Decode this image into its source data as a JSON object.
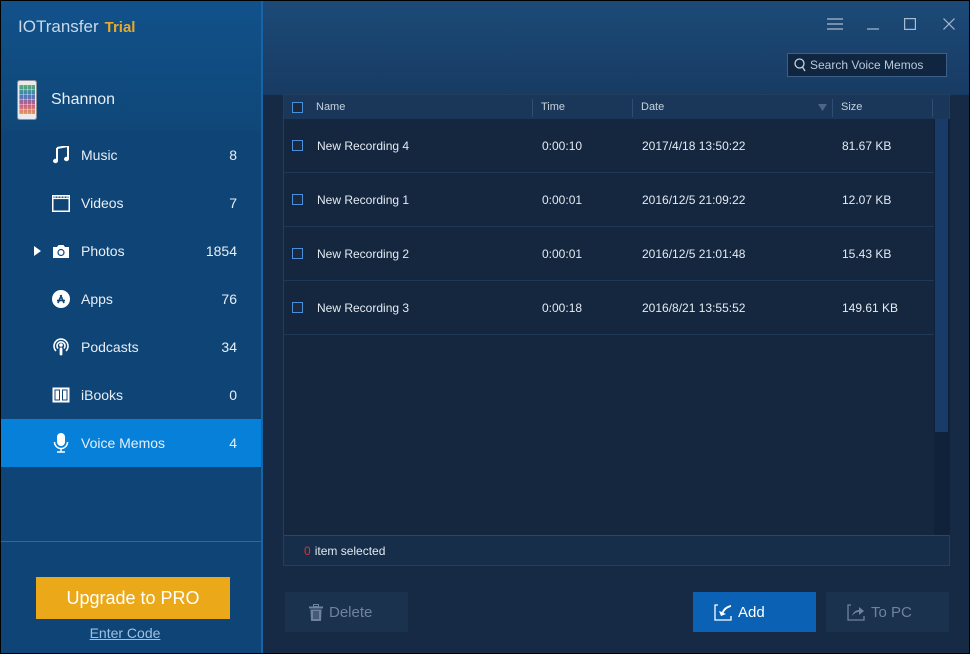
{
  "app": {
    "name": "IOTransfer",
    "edition": "Trial"
  },
  "device": {
    "name": "Shannon",
    "icon": "iphone-icon"
  },
  "sidebar": {
    "items": [
      {
        "label": "Music",
        "count": "8",
        "icon": "music-note-icon",
        "active": false,
        "expandable": false
      },
      {
        "label": "Videos",
        "count": "7",
        "icon": "clapperboard-icon",
        "active": false,
        "expandable": false
      },
      {
        "label": "Photos",
        "count": "1854",
        "icon": "camera-icon",
        "active": false,
        "expandable": true
      },
      {
        "label": "Apps",
        "count": "76",
        "icon": "app-store-icon",
        "active": false,
        "expandable": false
      },
      {
        "label": "Podcasts",
        "count": "34",
        "icon": "podcast-icon",
        "active": false,
        "expandable": false
      },
      {
        "label": "iBooks",
        "count": "0",
        "icon": "book-icon",
        "active": false,
        "expandable": false
      },
      {
        "label": "Voice Memos",
        "count": "4",
        "icon": "microphone-icon",
        "active": true,
        "expandable": false
      }
    ],
    "upgrade_label": "Upgrade to PRO",
    "enter_code_label": "Enter Code"
  },
  "window_controls": {
    "menu": "menu-icon",
    "minimize": "minimize-icon",
    "maximize": "maximize-icon",
    "close": "close-icon"
  },
  "search": {
    "placeholder": "Search Voice Memos",
    "value": ""
  },
  "table": {
    "columns": [
      {
        "key": "name",
        "label": "Name"
      },
      {
        "key": "time",
        "label": "Time"
      },
      {
        "key": "date",
        "label": "Date",
        "sorted": "descending"
      },
      {
        "key": "size",
        "label": "Size"
      }
    ],
    "rows": [
      {
        "name": "New Recording 4",
        "time": "0:00:10",
        "date": "2017/4/18 13:50:22",
        "size": "81.67 KB",
        "checked": false
      },
      {
        "name": "New Recording 1",
        "time": "0:00:01",
        "date": "2016/12/5 21:09:22",
        "size": "12.07 KB",
        "checked": false
      },
      {
        "name": "New Recording 2",
        "time": "0:00:01",
        "date": "2016/12/5 21:01:48",
        "size": "15.43 KB",
        "checked": false
      },
      {
        "name": "New Recording 3",
        "time": "0:00:18",
        "date": "2016/8/21 13:55:52",
        "size": "149.61 KB",
        "checked": false
      }
    ]
  },
  "status": {
    "selected_count": "0",
    "selected_text": "item selected"
  },
  "actions": {
    "delete_label": "Delete",
    "add_label": "Add",
    "to_pc_label": "To PC"
  },
  "colors": {
    "accent": "#0680d9",
    "upgrade": "#eba91a",
    "trial": "#e8a92a",
    "selected_count": "#e03030",
    "primary_button": "#0b62b4"
  }
}
